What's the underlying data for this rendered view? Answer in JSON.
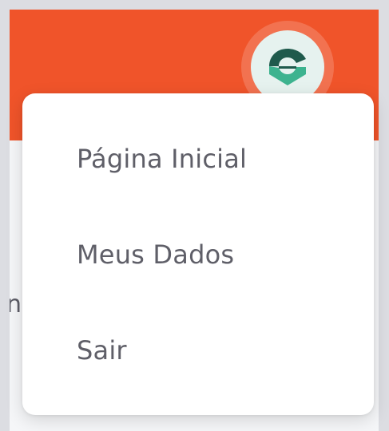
{
  "colors": {
    "header": "#f0542a",
    "logo_dark": "#1f5a4c",
    "logo_light": "#3db38f",
    "menu_text": "#5f5f68"
  },
  "header": {
    "avatar_icon": "c-logo-icon"
  },
  "background": {
    "cut_text": "n"
  },
  "menu": {
    "items": [
      {
        "label": "Página Inicial"
      },
      {
        "label": "Meus Dados"
      },
      {
        "label": "Sair"
      }
    ]
  }
}
